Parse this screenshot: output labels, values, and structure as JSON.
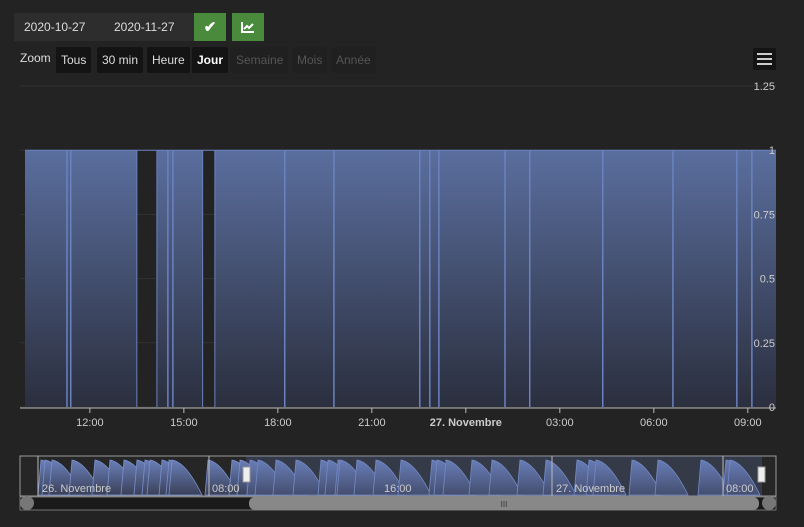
{
  "toolbar": {
    "date_from": "2020-10-27",
    "date_to": "2020-11-27",
    "apply_icon": "check-icon",
    "chart_icon": "chart-line-icon"
  },
  "zoom": {
    "label": "Zoom",
    "buttons": [
      {
        "label": "Tous",
        "state": "enabled"
      },
      {
        "label": "30 min",
        "state": "enabled"
      },
      {
        "label": "Heure",
        "state": "enabled"
      },
      {
        "label": "Jour",
        "state": "active"
      },
      {
        "label": "Semaine",
        "state": "disabled"
      },
      {
        "label": "Mois",
        "state": "disabled"
      },
      {
        "label": "Année",
        "state": "disabled"
      }
    ]
  },
  "menu_icon": "hamburger-icon",
  "colors": {
    "fill": "#5a6e9e",
    "line": "#6a82c0",
    "bg": "#232323"
  },
  "chart_data": {
    "type": "area",
    "x_unit": "hours since 26 Nov 00:00",
    "xlim": [
      9.93,
      33.9
    ],
    "ylim": [
      0,
      1.25
    ],
    "yticks": [
      "0",
      "0.25",
      "0.5",
      "0.75",
      "1",
      "1.25"
    ],
    "xticks": [
      {
        "x": 12,
        "label": "12:00"
      },
      {
        "x": 15,
        "label": "15:00"
      },
      {
        "x": 18,
        "label": "18:00"
      },
      {
        "x": 21,
        "label": "21:00"
      },
      {
        "x": 24,
        "label": "27. Novembre",
        "bold": true
      },
      {
        "x": 27,
        "label": "03:00"
      },
      {
        "x": 30,
        "label": "06:00"
      },
      {
        "x": 33,
        "label": "09:00"
      }
    ],
    "base_value": 1,
    "zero_gaps": [
      [
        13.5,
        14.14
      ],
      [
        15.6,
        15.99
      ]
    ],
    "zero_spikes": [
      11.27,
      11.39,
      14.49,
      14.65,
      18.22,
      19.79,
      22.53,
      22.85,
      23.14,
      25.25,
      26.04,
      28.37,
      30.61,
      32.65,
      33.13
    ]
  },
  "navigator": {
    "labels": [
      "26. Novembre",
      "08:00",
      "16:00",
      "27. Novembre",
      "08:00"
    ],
    "scroll_grip": "III"
  }
}
